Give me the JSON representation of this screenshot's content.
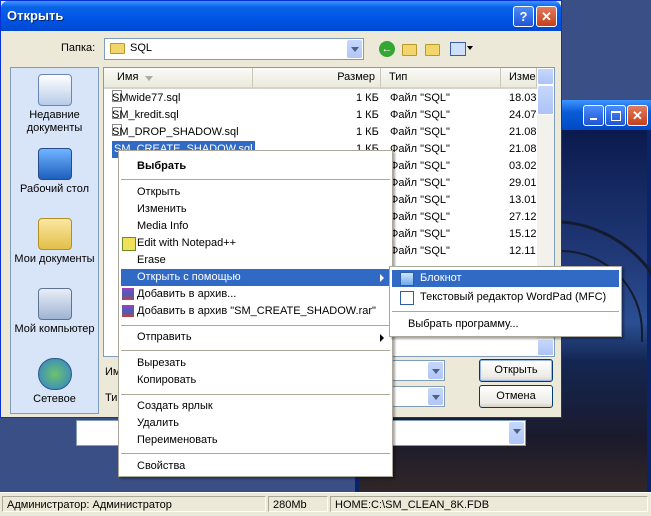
{
  "dialog": {
    "title": "Открыть",
    "folder_label": "Папка:",
    "folder_value": "SQL",
    "filename_label_partial": "Им",
    "filetype_label_partial": "Ти",
    "open_button": "Открыть",
    "cancel_button": "Отмена",
    "help_glyph": "?",
    "close_glyph": "✕"
  },
  "places": [
    {
      "label": "Недавние документы",
      "icon": "recent-documents-icon"
    },
    {
      "label": "Рабочий стол",
      "icon": "desktop-icon"
    },
    {
      "label": "Мои документы",
      "icon": "my-documents-icon"
    },
    {
      "label": "Мой компьютер",
      "icon": "my-computer-icon"
    },
    {
      "label": "Сетевое",
      "icon": "network-icon"
    }
  ],
  "columns": {
    "name": "Имя",
    "size": "Размер",
    "type": "Тип",
    "modified": "Изме"
  },
  "files": [
    {
      "name": "SMwide77.sql",
      "size": "1 КБ",
      "type": "Файл \"SQL\"",
      "date": "18.03"
    },
    {
      "name": "SM_kredit.sql",
      "size": "1 КБ",
      "type": "Файл \"SQL\"",
      "date": "24.07"
    },
    {
      "name": "SM_DROP_SHADOW.sql",
      "size": "1 КБ",
      "type": "Файл \"SQL\"",
      "date": "21.08"
    },
    {
      "name": "SM_CREATE_SHADOW.sql",
      "size": "1 КБ",
      "type": "Файл \"SQL\"",
      "date": "21.08"
    },
    {
      "name": "",
      "size": "",
      "type": "Файл \"SQL\"",
      "date": "03.02"
    },
    {
      "name": "",
      "size": "",
      "type": "Файл \"SQL\"",
      "date": "29.01"
    },
    {
      "name": "",
      "size": "",
      "type": "Файл \"SQL\"",
      "date": "13.01"
    },
    {
      "name": "",
      "size": "",
      "type": "Файл \"SQL\"",
      "date": "27.12"
    },
    {
      "name": "",
      "size": "",
      "type": "Файл \"SQL\"",
      "date": "15.12"
    },
    {
      "name": "",
      "size": "",
      "type": "Файл \"SQL\"",
      "date": "12.11"
    }
  ],
  "context_menu": [
    {
      "label": "Выбрать",
      "bold": true
    },
    {
      "sep": true
    },
    {
      "label": "Открыть"
    },
    {
      "label": "Изменить"
    },
    {
      "label": "Media Info"
    },
    {
      "label": "Edit with Notepad++",
      "icon": "notepadpp-icon"
    },
    {
      "label": "Erase"
    },
    {
      "label": "Открыть с помощью",
      "submenu": true,
      "highlight": true
    },
    {
      "label": "Добавить в архив...",
      "icon": "winrar-icon"
    },
    {
      "label": "Добавить в архив \"SM_CREATE_SHADOW.rar\"",
      "icon": "winrar-icon"
    },
    {
      "sep": true
    },
    {
      "label": "Отправить",
      "submenu": true
    },
    {
      "sep": true
    },
    {
      "label": "Вырезать"
    },
    {
      "label": "Копировать"
    },
    {
      "sep": true
    },
    {
      "label": "Создать ярлык"
    },
    {
      "label": "Удалить"
    },
    {
      "label": "Переименовать"
    },
    {
      "sep": true
    },
    {
      "label": "Свойства"
    }
  ],
  "open_with_menu": [
    {
      "label": "Блокнот",
      "icon": "notepad-icon",
      "highlight": true
    },
    {
      "label": "Текстовый редактор WordPad (MFC)",
      "icon": "wordpad-icon"
    },
    {
      "sep": true
    },
    {
      "label": "Выбрать программу..."
    }
  ],
  "statusbar": {
    "user": "Администратор: Администратор",
    "memory": "280Mb",
    "database": "HOME:C:\\SM_CLEAN_8K.FDB"
  }
}
